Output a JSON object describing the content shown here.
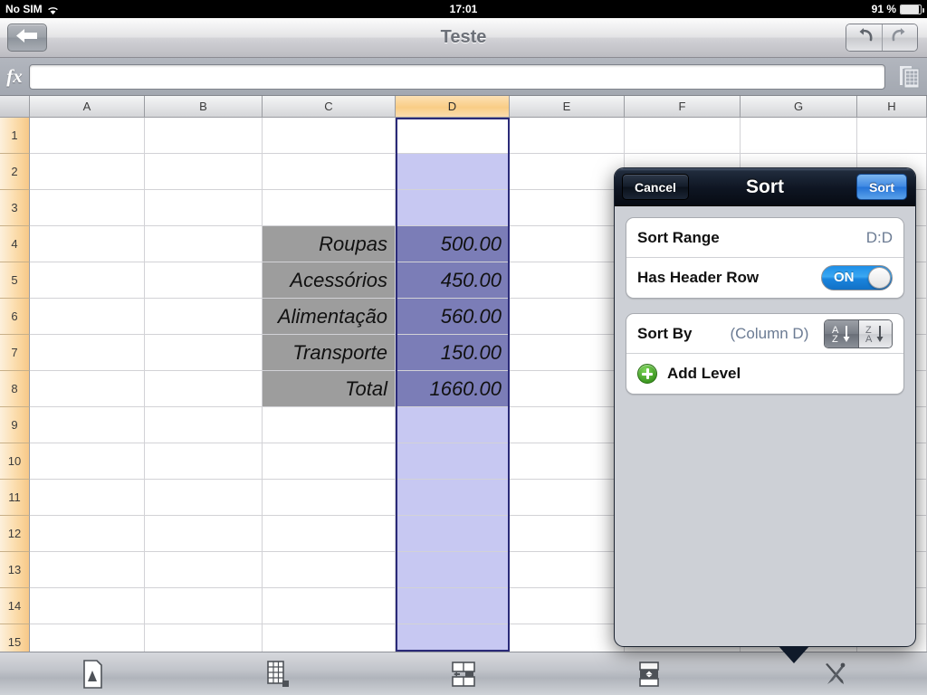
{
  "statusbar": {
    "carrier": "No SIM",
    "wifi_icon": "wifi-icon",
    "time": "17:01",
    "battery_percent": "91 %",
    "battery_icon": "battery-icon"
  },
  "navbar": {
    "back_icon": "back-arrow-icon",
    "title": "Teste",
    "undo_icon": "undo-icon",
    "redo_icon": "redo-icon"
  },
  "formulabar": {
    "fx_label": "fx",
    "value": "",
    "placeholder": "",
    "sheets_icon": "sheets-icon"
  },
  "grid": {
    "columns": [
      "A",
      "B",
      "C",
      "D",
      "E",
      "F",
      "G",
      "H"
    ],
    "selected_column": "D",
    "rows": [
      "1",
      "2",
      "3",
      "4",
      "5",
      "6",
      "7",
      "8",
      "9",
      "10",
      "11",
      "12",
      "13",
      "14",
      "15"
    ],
    "cells": [
      {
        "row": 4,
        "label": "Roupas",
        "value": "500.00"
      },
      {
        "row": 5,
        "label": "Acessórios",
        "value": "450.00"
      },
      {
        "row": 6,
        "label": "Alimentação",
        "value": "560.00"
      },
      {
        "row": 7,
        "label": "Transporte",
        "value": "150.00"
      },
      {
        "row": 8,
        "label": "Total",
        "value": "1660.00"
      }
    ]
  },
  "bottombar": {
    "tools": [
      {
        "name": "document-setup-icon",
        "label": ""
      },
      {
        "name": "table-icon",
        "label": ""
      },
      {
        "name": "insert-cells-icon",
        "label": ""
      },
      {
        "name": "merge-cells-icon",
        "label": ""
      },
      {
        "name": "tools-icon",
        "label": ""
      }
    ]
  },
  "sort_popover": {
    "cancel_label": "Cancel",
    "title": "Sort",
    "sort_label": "Sort",
    "sort_range_label": "Sort Range",
    "sort_range_value": "D:D",
    "has_header_label": "Has Header Row",
    "has_header_state": "ON",
    "sort_by_label": "Sort By",
    "sort_by_value": "(Column D)",
    "asc_icon": "sort-ascending-icon",
    "desc_icon": "sort-descending-icon",
    "add_level_label": "Add Level",
    "add_level_icon": "plus-circle-icon"
  },
  "colors": {
    "selection_header": "#f9cd86",
    "selection_fill_dark": "#7b7db7",
    "selection_fill_light": "#c7c8f2",
    "label_cell_fill": "#9d9d9d",
    "toggle_on": "#1d8fe8",
    "action_button": "#3d87e2",
    "add_level_green": "#3f9a23"
  }
}
